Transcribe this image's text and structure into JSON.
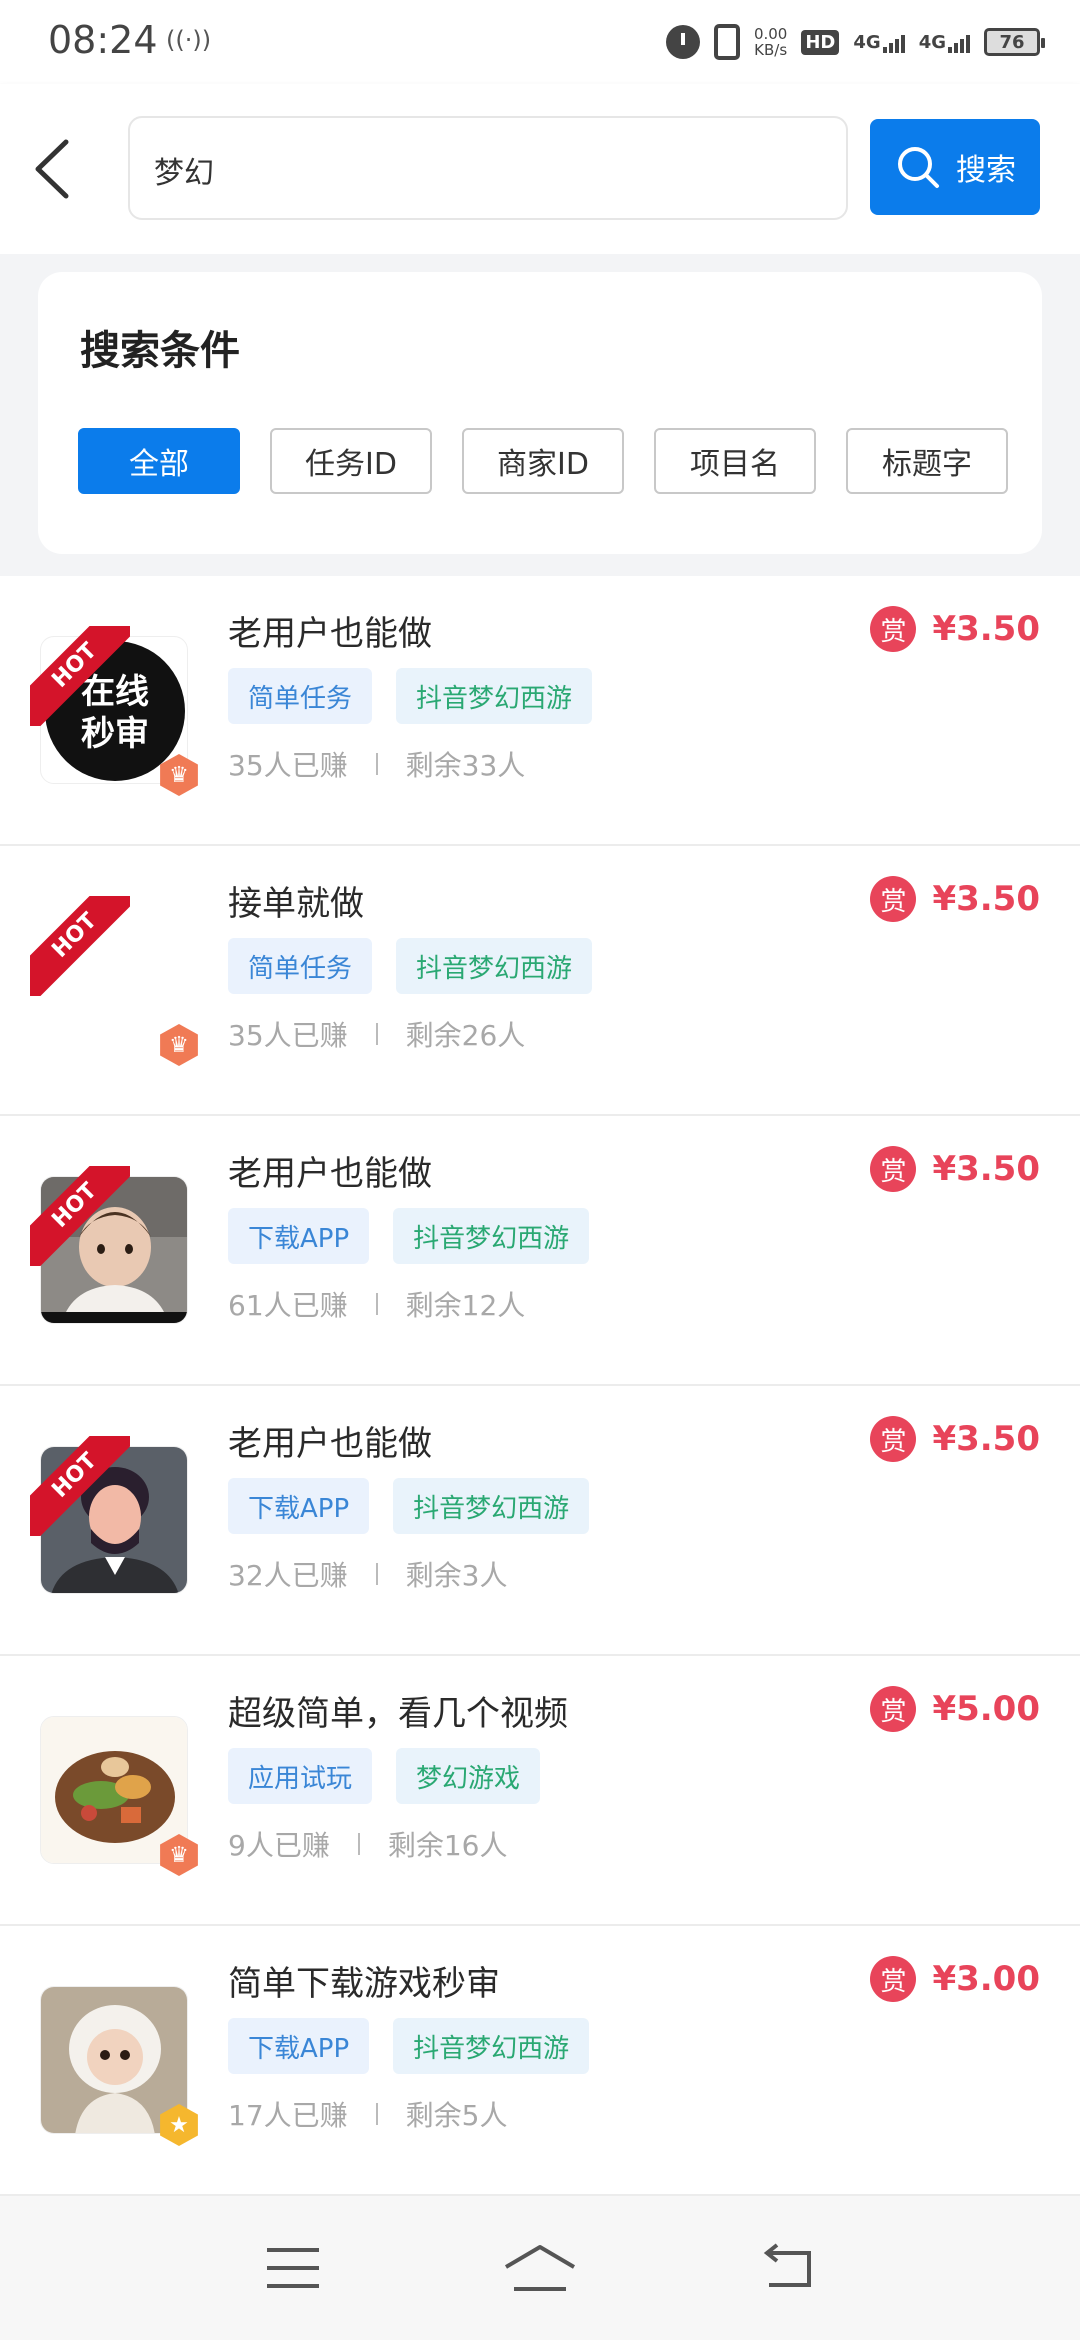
{
  "status_bar": {
    "time": "08:24",
    "net_speed_value": "0.00",
    "net_speed_unit": "KB/s",
    "hd_label": "HD",
    "sim1_label": "4G",
    "sim2_label": "4G",
    "battery_level": "76"
  },
  "search": {
    "query": "梦幻",
    "button_label": "搜索"
  },
  "conditions": {
    "title": "搜索条件",
    "options": [
      "全部",
      "任务ID",
      "商家ID",
      "项目名",
      "标题字"
    ],
    "selected": "全部"
  },
  "tasks": [
    {
      "title": "老用户也能做",
      "tags": [
        "简单任务",
        "抖音梦幻西游"
      ],
      "earned": "35人已赚",
      "remaining": "剩余33人",
      "reward_label": "赏",
      "price": "¥3.50",
      "hot": "HOT",
      "thumb_text": [
        "在线",
        "秒审"
      ],
      "badge": "crown"
    },
    {
      "title": "接单就做",
      "tags": [
        "简单任务",
        "抖音梦幻西游"
      ],
      "earned": "35人已赚",
      "remaining": "剩余26人",
      "reward_label": "赏",
      "price": "¥3.50",
      "hot": "HOT",
      "badge": "crown"
    },
    {
      "title": "老用户也能做",
      "tags": [
        "下载APP",
        "抖音梦幻西游"
      ],
      "earned": "61人已赚",
      "remaining": "剩余12人",
      "reward_label": "赏",
      "price": "¥3.50",
      "hot": "HOT",
      "badge": "none"
    },
    {
      "title": "老用户也能做",
      "tags": [
        "下载APP",
        "抖音梦幻西游"
      ],
      "earned": "32人已赚",
      "remaining": "剩余3人",
      "reward_label": "赏",
      "price": "¥3.50",
      "hot": "HOT",
      "badge": "none"
    },
    {
      "title": "超级简单，看几个视频",
      "tags": [
        "应用试玩",
        "梦幻游戏"
      ],
      "earned": "9人已赚",
      "remaining": "剩余16人",
      "reward_label": "赏",
      "price": "¥5.00",
      "badge": "crown"
    },
    {
      "title": "简单下载游戏秒审",
      "tags": [
        "下载APP",
        "抖音梦幻西游"
      ],
      "earned": "17人已赚",
      "remaining": "剩余5人",
      "reward_label": "赏",
      "price": "¥3.00",
      "badge": "star"
    }
  ],
  "icons": {
    "back": "chevron-left-icon",
    "search": "search-icon",
    "nav": [
      "menu-icon",
      "home-icon",
      "return-icon"
    ]
  },
  "colors": {
    "primary": "#0b7ceb",
    "reward": "#e8445a",
    "hot": "#d4142a",
    "tag_bg": "#eaf2fd"
  }
}
